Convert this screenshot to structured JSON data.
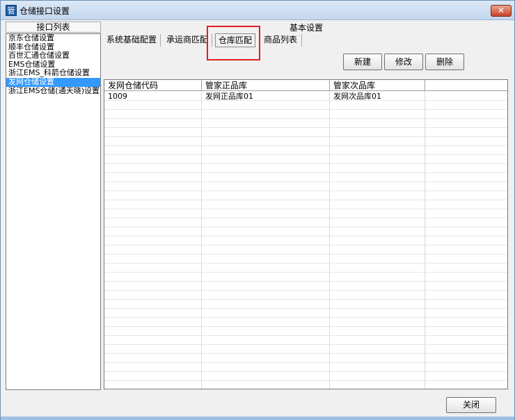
{
  "window": {
    "title": "仓储接口设置",
    "app_icon_glyph": "管",
    "close_glyph": "✕"
  },
  "sidebar": {
    "header": "接口列表",
    "items": [
      {
        "label": "京东仓储设置",
        "selected": false
      },
      {
        "label": "顺丰仓储设置",
        "selected": false
      },
      {
        "label": "百世汇通仓储设置",
        "selected": false
      },
      {
        "label": "EMS仓储设置",
        "selected": false
      },
      {
        "label": "浙江EMS_科箭仓储设置",
        "selected": false
      },
      {
        "label": "发网仓储设置",
        "selected": true
      },
      {
        "label": "浙江EMS仓储(通天晓)设置",
        "selected": false
      }
    ]
  },
  "main": {
    "group_title": "基本设置",
    "tabs": [
      {
        "label": "系统基础配置",
        "active": false
      },
      {
        "label": "承运商匹配",
        "active": false
      },
      {
        "label": "仓库匹配",
        "active": true
      },
      {
        "label": "商品列表",
        "active": false
      }
    ],
    "buttons": {
      "new": "新建",
      "edit": "修改",
      "delete": "删除"
    },
    "table": {
      "columns": [
        "发网仓储代码",
        "管家正品库",
        "管家次品库",
        ""
      ],
      "rows": [
        [
          "1009",
          "发网正品库01",
          "发网次品库01",
          ""
        ]
      ]
    }
  },
  "footer": {
    "close_label": "关闭"
  },
  "colors": {
    "selection": "#3399ff",
    "highlight_box": "#e02020",
    "title_bar": "#c3d7ee"
  }
}
